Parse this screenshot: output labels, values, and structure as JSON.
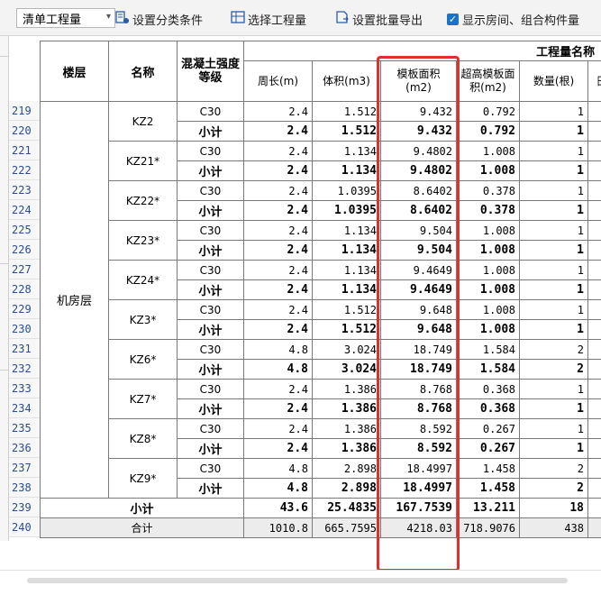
{
  "toolbar": {
    "dropdown_value": "清单工程量",
    "set_category": "设置分类条件",
    "select_quantity": "选择工程量",
    "batch_export": "设置批量导出",
    "show_rooms": "显示房间、组合构件量"
  },
  "table": {
    "headers": {
      "floor": "楼层",
      "name": "名称",
      "grade": "混凝土强度等级",
      "group": "工程量名称",
      "perimeter": "周长(m)",
      "volume": "体积(m3)",
      "formwork": "模板面积(m2)",
      "over_formwork": "超高模板面积(m2)",
      "count": "数量(根)",
      "cut": "昍"
    },
    "floor_name": "机房层",
    "groups": [
      {
        "name": "KZ2",
        "row": {
          "n": "219",
          "grade": "C30",
          "perimeter": "2.4",
          "volume": "1.512",
          "formwork": "9.432",
          "over": "0.792",
          "count": "1"
        },
        "sub": {
          "n": "220",
          "label": "小计",
          "perimeter": "2.4",
          "volume": "1.512",
          "formwork": "9.432",
          "over": "0.792",
          "count": "1"
        }
      },
      {
        "name": "KZ21*",
        "row": {
          "n": "221",
          "grade": "C30",
          "perimeter": "2.4",
          "volume": "1.134",
          "formwork": "9.4802",
          "over": "1.008",
          "count": "1"
        },
        "sub": {
          "n": "222",
          "label": "小计",
          "perimeter": "2.4",
          "volume": "1.134",
          "formwork": "9.4802",
          "over": "1.008",
          "count": "1"
        }
      },
      {
        "name": "KZ22*",
        "row": {
          "n": "223",
          "grade": "C30",
          "perimeter": "2.4",
          "volume": "1.0395",
          "formwork": "8.6402",
          "over": "0.378",
          "count": "1"
        },
        "sub": {
          "n": "224",
          "label": "小计",
          "perimeter": "2.4",
          "volume": "1.0395",
          "formwork": "8.6402",
          "over": "0.378",
          "count": "1"
        }
      },
      {
        "name": "KZ23*",
        "row": {
          "n": "225",
          "grade": "C30",
          "perimeter": "2.4",
          "volume": "1.134",
          "formwork": "9.504",
          "over": "1.008",
          "count": "1"
        },
        "sub": {
          "n": "226",
          "label": "小计",
          "perimeter": "2.4",
          "volume": "1.134",
          "formwork": "9.504",
          "over": "1.008",
          "count": "1"
        }
      },
      {
        "name": "KZ24*",
        "row": {
          "n": "227",
          "grade": "C30",
          "perimeter": "2.4",
          "volume": "1.134",
          "formwork": "9.4649",
          "over": "1.008",
          "count": "1"
        },
        "sub": {
          "n": "228",
          "label": "小计",
          "perimeter": "2.4",
          "volume": "1.134",
          "formwork": "9.4649",
          "over": "1.008",
          "count": "1"
        }
      },
      {
        "name": "KZ3*",
        "row": {
          "n": "229",
          "grade": "C30",
          "perimeter": "2.4",
          "volume": "1.512",
          "formwork": "9.648",
          "over": "1.008",
          "count": "1"
        },
        "sub": {
          "n": "230",
          "label": "小计",
          "perimeter": "2.4",
          "volume": "1.512",
          "formwork": "9.648",
          "over": "1.008",
          "count": "1"
        }
      },
      {
        "name": "KZ6*",
        "row": {
          "n": "231",
          "grade": "C30",
          "perimeter": "4.8",
          "volume": "3.024",
          "formwork": "18.749",
          "over": "1.584",
          "count": "2"
        },
        "sub": {
          "n": "232",
          "label": "小计",
          "perimeter": "4.8",
          "volume": "3.024",
          "formwork": "18.749",
          "over": "1.584",
          "count": "2"
        }
      },
      {
        "name": "KZ7*",
        "row": {
          "n": "233",
          "grade": "C30",
          "perimeter": "2.4",
          "volume": "1.386",
          "formwork": "8.768",
          "over": "0.368",
          "count": "1"
        },
        "sub": {
          "n": "234",
          "label": "小计",
          "perimeter": "2.4",
          "volume": "1.386",
          "formwork": "8.768",
          "over": "0.368",
          "count": "1"
        }
      },
      {
        "name": "KZ8*",
        "row": {
          "n": "235",
          "grade": "C30",
          "perimeter": "2.4",
          "volume": "1.386",
          "formwork": "8.592",
          "over": "0.267",
          "count": "1"
        },
        "sub": {
          "n": "236",
          "label": "小计",
          "perimeter": "2.4",
          "volume": "1.386",
          "formwork": "8.592",
          "over": "0.267",
          "count": "1"
        }
      },
      {
        "name": "KZ9*",
        "row": {
          "n": "237",
          "grade": "C30",
          "perimeter": "4.8",
          "volume": "2.898",
          "formwork": "18.4997",
          "over": "1.458",
          "count": "2"
        },
        "sub": {
          "n": "238",
          "label": "小计",
          "perimeter": "4.8",
          "volume": "2.898",
          "formwork": "18.4997",
          "over": "1.458",
          "count": "2"
        }
      }
    ],
    "floor_subtotal": {
      "n": "239",
      "label": "小计",
      "perimeter": "43.6",
      "volume": "25.4835",
      "formwork": "167.7539",
      "over": "13.211",
      "count": "18"
    },
    "grand_total": {
      "n": "240",
      "label": "合计",
      "perimeter": "1010.8",
      "volume": "665.7595",
      "formwork": "4218.03",
      "over": "718.9076",
      "count": "438"
    }
  },
  "colors": {
    "highlight": "#e0302b",
    "row_number": "#2b4f8a",
    "checkbox": "#1a73c8"
  }
}
